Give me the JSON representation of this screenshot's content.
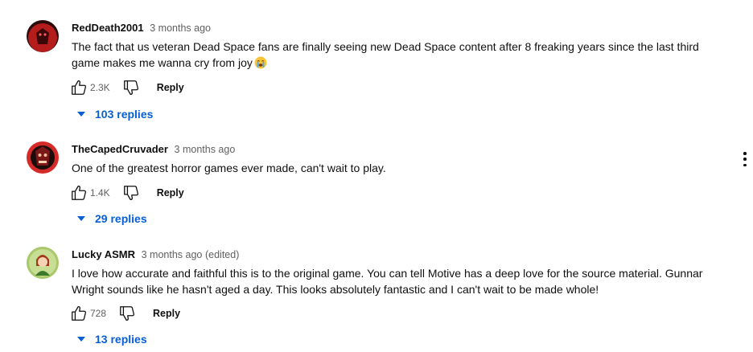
{
  "comments": [
    {
      "author": "RedDeath2001",
      "time": "3 months ago",
      "edited": "",
      "text": "The fact that us veteran Dead Space fans are finally seeing new Dead Space content after 8 freaking years since the last third game makes me wanna cry from joy",
      "emoji_icon": "crying-face-emoji",
      "likes": "2.3K",
      "reply_label": "Reply",
      "replies_label": "103 replies",
      "avatar_color": "#b51d1d"
    },
    {
      "author": "TheCapedCruvader",
      "time": "3 months ago",
      "edited": "",
      "text": "One of the greatest horror games ever made, can't wait to play.",
      "likes": "1.4K",
      "reply_label": "Reply",
      "replies_label": "29 replies",
      "avatar_color": "#d52a2a"
    },
    {
      "author": "Lucky ASMR",
      "time": "3 months ago",
      "edited": "(edited)",
      "text": "I love how accurate and faithful this is to the original game. You can tell Motive has a deep love for the source material. Gunnar Wright sounds like he hasn't aged a day. This looks absolutely fantastic and I can't wait to be made whole!",
      "likes": "728",
      "reply_label": "Reply",
      "replies_label": "13 replies",
      "avatar_color": "#a8c86a"
    }
  ],
  "icons": {
    "like": "thumbs-up-icon",
    "dislike": "thumbs-down-icon",
    "menu": "more-vert-icon",
    "expand": "caret-down-icon"
  },
  "colors": {
    "link_blue": "#065fd4",
    "meta_gray": "#606060",
    "text": "#0f0f0f"
  }
}
